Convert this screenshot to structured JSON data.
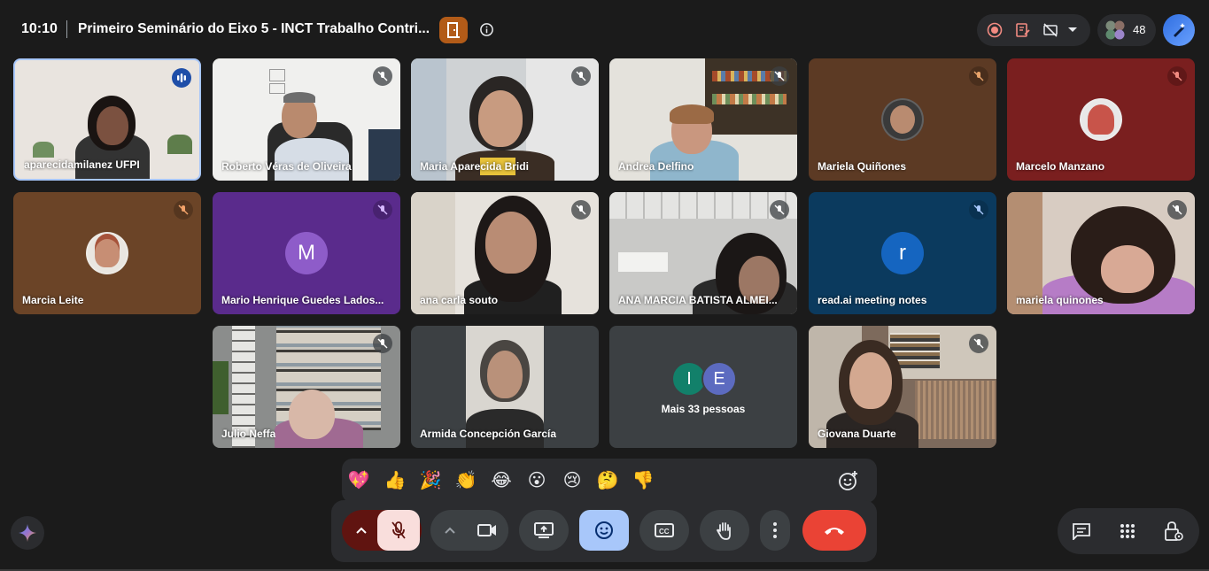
{
  "header": {
    "time": "10:10",
    "title": "Primeiro Seminário do Eixo 5 - INCT Trabalho Contri...",
    "participants_count": "48"
  },
  "tiles": [
    {
      "name": "aparecidamilanez UFPI"
    },
    {
      "name": "Roberto Véras de Oliveira"
    },
    {
      "name": "Maria Aparecida Bridi"
    },
    {
      "name": "Andrea Delfino"
    },
    {
      "name": "Mariela Quiñones"
    },
    {
      "name": "Marcelo Manzano"
    },
    {
      "name": "Marcia Leite"
    },
    {
      "name": "Mario Henrique Guedes Lados...",
      "initial": "M"
    },
    {
      "name": "ana carla souto"
    },
    {
      "name": "ANA MARCIA BATISTA ALMEI..."
    },
    {
      "name": "read.ai meeting notes",
      "initial": "r"
    },
    {
      "name": "mariela quinones"
    },
    {
      "name": "Julio Neffa"
    },
    {
      "name": "Armida Concepción García"
    },
    {
      "name": "Mais 33 pessoas",
      "avatars": [
        "I",
        "E"
      ]
    },
    {
      "name": "Giovana Duarte"
    }
  ],
  "reactions": [
    "💖",
    "👍",
    "🎉",
    "👏",
    "😂",
    "😮",
    "😢",
    "🤔",
    "👎"
  ],
  "icons": {
    "record": "record-icon",
    "notes": "notes-icon",
    "captions-off": "no-video-icon",
    "people": "people-icon",
    "ai": "ai-pen-icon",
    "mic-off": "mic-off-icon",
    "camera": "camera-icon",
    "present": "present-icon",
    "emoji": "emoji-icon",
    "captions": "captions-icon",
    "hand": "raise-hand-icon",
    "more": "more-vert-icon",
    "hangup": "hang-up-icon",
    "chat": "chat-icon",
    "activities": "apps-icon",
    "host": "host-controls-icon"
  },
  "colors": {
    "hangup": "#ea4335",
    "mic_muted_bg": "#f9dedc",
    "emoji_active_bg": "#a8c7fa",
    "purple_tile": "#5a2b8c",
    "blue_tile": "#0b3a5e"
  }
}
